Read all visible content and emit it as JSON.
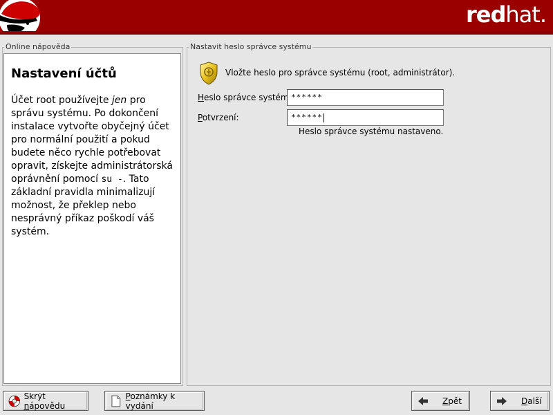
{
  "header": {
    "brand_bold": "red",
    "brand_light": "hat."
  },
  "help": {
    "frame_label": "Online nápověda",
    "title": "Nastavení účtů",
    "text_1": "Účet root používejte ",
    "text_em": "jen",
    "text_2": " pro správu systému. Po dokončení instalace vytvořte obyčejný účet pro normální použití a pokud budete něco rychle potřebovat opravit, získejte administrátorská oprávnění pomocí ",
    "text_cmd": "su -",
    "text_3": ". Tato základní pravidla minimalizují možnost, že překlep nebo nesprávný příkaz poškodí váš systém."
  },
  "main": {
    "frame_label": "Nastavit heslo správce systému",
    "intro": "Vložte heslo pro správce systému (root, administrátor).",
    "password_label_mnemonic": "H",
    "password_label_rest": "eslo správce systému:",
    "password_value": "******",
    "confirm_label_mnemonic": "P",
    "confirm_label_rest": "otvrzení:",
    "confirm_value": "******",
    "status": "Heslo správce systému nastaveno."
  },
  "buttons": {
    "hide_help_pre": "Skrýt ",
    "hide_help_mnemonic": "n",
    "hide_help_post": "ápovědu",
    "notes_mnemonic": "P",
    "notes_rest": "oznámky k vydání",
    "back_mnemonic": "Z",
    "back_rest": "pět",
    "next_mnemonic": "D",
    "next_rest": "alší"
  },
  "colors": {
    "banner": "#9b0000",
    "window_bg": "#e6e6e6"
  },
  "icons": {
    "logo": "shadowman-logo-icon",
    "intro": "key-shield-icon",
    "hide_help": "lifebuoy-icon",
    "notes": "document-icon",
    "back": "arrow-left-icon",
    "next": "arrow-right-icon"
  }
}
